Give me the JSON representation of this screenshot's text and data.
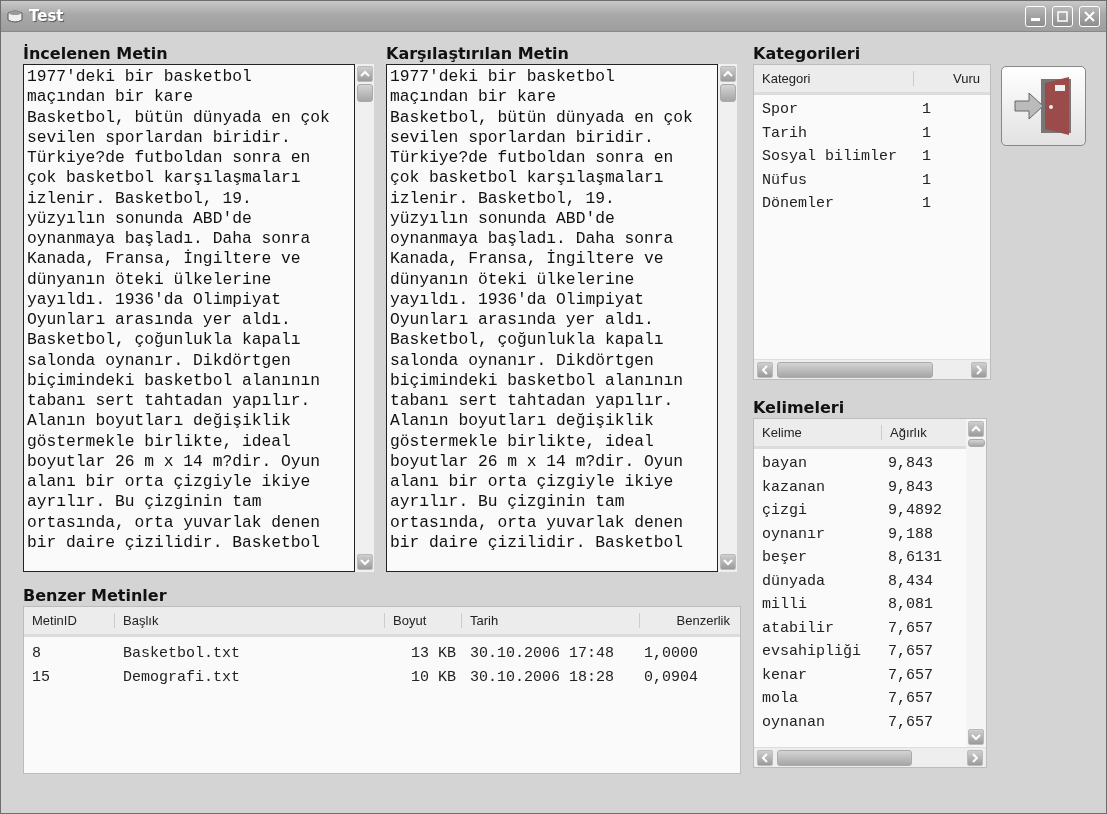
{
  "window": {
    "title": "Test"
  },
  "examined_text": {
    "title": "İncelenen Metin",
    "lines": [
      "1977'deki bir basketbol",
      "maçından bir kare",
      "Basketbol, bütün dünyada en çok",
      "sevilen sporlardan biridir.",
      "Türkiye?de futboldan sonra en",
      "çok basketbol karşılaşmaları",
      "izlenir. Basketbol, 19.",
      "yüzyılın sonunda ABD'de",
      "oynanmaya başladı. Daha sonra",
      "Kanada, Fransa, İngiltere ve",
      "dünyanın öteki ülkelerine",
      "yayıldı. 1936'da Olimpiyat",
      "Oyunları arasında yer aldı.",
      "Basketbol, çoğunlukla kapalı",
      "salonda oynanır. Dikdörtgen",
      "biçimindeki basketbol alanının",
      "tabanı sert tahtadan yapılır.",
      "Alanın boyutları değişiklik",
      "göstermekle birlikte, ideal",
      "boyutlar 26 m x 14 m?dir. Oyun",
      "alanı bir orta çizgiyle ikiye",
      "ayrılır. Bu çizginin tam",
      "ortasında, orta yuvarlak denen",
      "bir daire çizilidir. Basketbol"
    ]
  },
  "compared_text": {
    "title": "Karşılaştırılan Metin",
    "lines": [
      "1977'deki bir basketbol",
      "maçından bir kare",
      "Basketbol, bütün dünyada en çok",
      "sevilen sporlardan biridir.",
      "Türkiye?de futboldan sonra en",
      "çok basketbol karşılaşmaları",
      "izlenir. Basketbol, 19.",
      "yüzyılın sonunda ABD'de",
      "oynanmaya başladı. Daha sonra",
      "Kanada, Fransa, İngiltere ve",
      "dünyanın öteki ülkelerine",
      "yayıldı. 1936'da Olimpiyat",
      "Oyunları arasında yer aldı.",
      "Basketbol, çoğunlukla kapalı",
      "salonda oynanır. Dikdörtgen",
      "biçimindeki basketbol alanının",
      "tabanı sert tahtadan yapılır.",
      "Alanın boyutları değişiklik",
      "göstermekle birlikte, ideal",
      "boyutlar 26 m x 14 m?dir. Oyun",
      "alanı bir orta çizgiyle ikiye",
      "ayrılır. Bu çizginin tam",
      "ortasında, orta yuvarlak denen",
      "bir daire çizilidir. Basketbol"
    ]
  },
  "categories": {
    "title": "Kategorileri",
    "columns": [
      "Kategori",
      "Vuru"
    ],
    "rows": [
      [
        "Spor",
        "1"
      ],
      [
        "Tarih",
        "1"
      ],
      [
        "Sosyal bilimler",
        "1"
      ],
      [
        "Nüfus",
        "1"
      ],
      [
        "Dönemler",
        "1"
      ]
    ]
  },
  "words": {
    "title": "Kelimeleri",
    "columns": [
      "Kelime",
      "Ağırlık"
    ],
    "rows": [
      [
        "bayan",
        "9,843"
      ],
      [
        "kazanan",
        "9,843"
      ],
      [
        "çizgi",
        "9,4892"
      ],
      [
        "oynanır",
        "9,188"
      ],
      [
        "beşer",
        "8,6131"
      ],
      [
        "dünyada",
        "8,434"
      ],
      [
        "milli",
        "8,081"
      ],
      [
        "atabilir",
        "7,657"
      ],
      [
        "evsahipliği",
        "7,657"
      ],
      [
        "kenar",
        "7,657"
      ],
      [
        "mola",
        "7,657"
      ],
      [
        "oynanan",
        "7,657"
      ]
    ]
  },
  "similar_texts": {
    "title": "Benzer Metinler",
    "columns": [
      "MetinID",
      "Başlık",
      "Boyut",
      "Tarih",
      "Benzerlik"
    ],
    "rows": [
      [
        "8",
        "Basketbol.txt",
        "13 KB",
        "30.10.2006 17:48",
        "1,0000"
      ],
      [
        "15",
        "Demografi.txt",
        "10 KB",
        "30.10.2006 18:28",
        "0,0904"
      ]
    ]
  }
}
